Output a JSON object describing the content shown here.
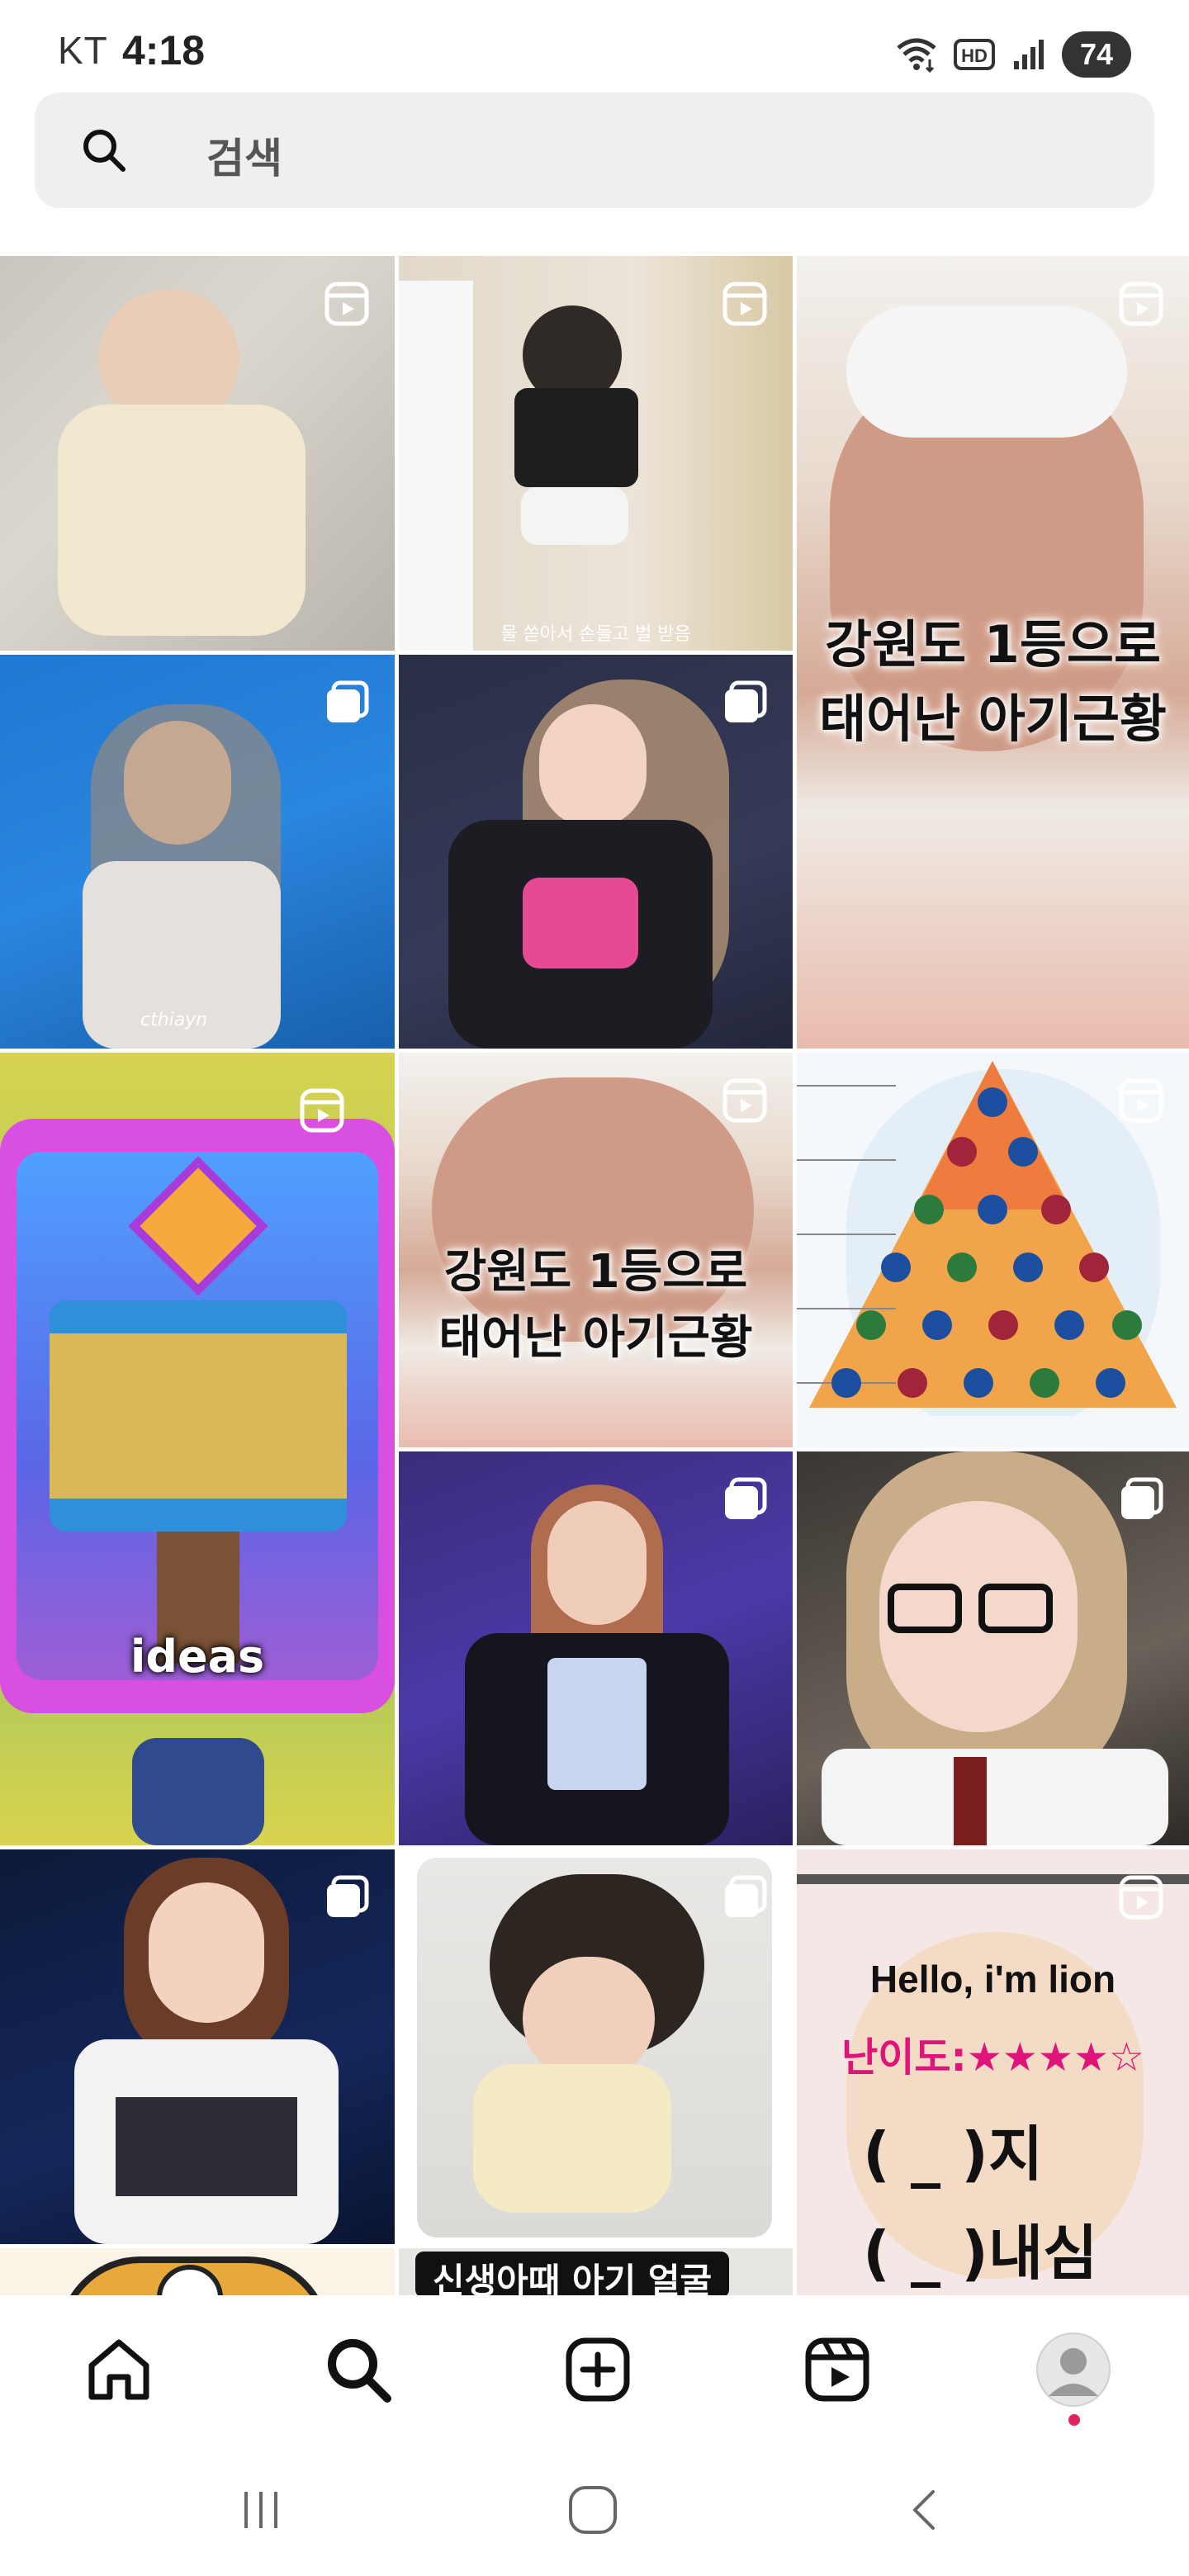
{
  "status_bar": {
    "carrier": "KT",
    "time": "4:18",
    "battery": "74",
    "icons": [
      "wifi-icon",
      "hd-icon",
      "signal-icon",
      "battery-icon"
    ]
  },
  "search": {
    "placeholder": "검색"
  },
  "grid": {
    "tiles": [
      {
        "subject": "baby lying on sofa",
        "type": "reel"
      },
      {
        "subject": "toddler standing against wall",
        "type": "reel",
        "caption": "물 쏟아서 손들고 벌 받음"
      },
      {
        "subject": "newborn baby face",
        "type": "reel",
        "caption_line1": "강원도 1등으로",
        "caption_line2": "태어난 아기근황"
      },
      {
        "subject": "performer waving on stage",
        "type": "carousel",
        "watermark": "cthiayn"
      },
      {
        "subject": "performer in hoodie on stage",
        "type": "carousel"
      },
      {
        "subject": "game hammer ideas",
        "type": "reel",
        "caption": "ideas"
      },
      {
        "subject": "newborn baby face",
        "type": "reel",
        "caption_line1": "강원도 1등으로",
        "caption_line2": "태어난 아기근황"
      },
      {
        "subject": "university ranking pyramid",
        "type": "reel"
      },
      {
        "subject": "performer arms raised",
        "type": "carousel"
      },
      {
        "subject": "girl with glasses",
        "type": "carousel"
      },
      {
        "subject": "performer in white sleeveless top",
        "type": "carousel"
      },
      {
        "subject": "baby with wild hair",
        "type": "carousel"
      },
      {
        "subject": "lion quiz card",
        "type": "reel",
        "line1": "Hello, i'm lion",
        "line2": "난이도:★★★★☆",
        "line3": "( _ )지",
        "line4": "( _ )내심"
      },
      {
        "subject": "cartoon face partial",
        "type": "carousel"
      },
      {
        "subject": "baby face partial",
        "type": "reel",
        "caption": "신생아때 아기 얼굴"
      },
      {
        "subject": "lion quiz card continued",
        "type": "reel"
      }
    ]
  },
  "bottom_nav": {
    "items": [
      "home-icon",
      "search-icon",
      "create-icon",
      "reels-icon",
      "profile-avatar"
    ]
  },
  "system_nav": {
    "items": [
      "recents-button",
      "home-button",
      "back-button"
    ]
  }
}
